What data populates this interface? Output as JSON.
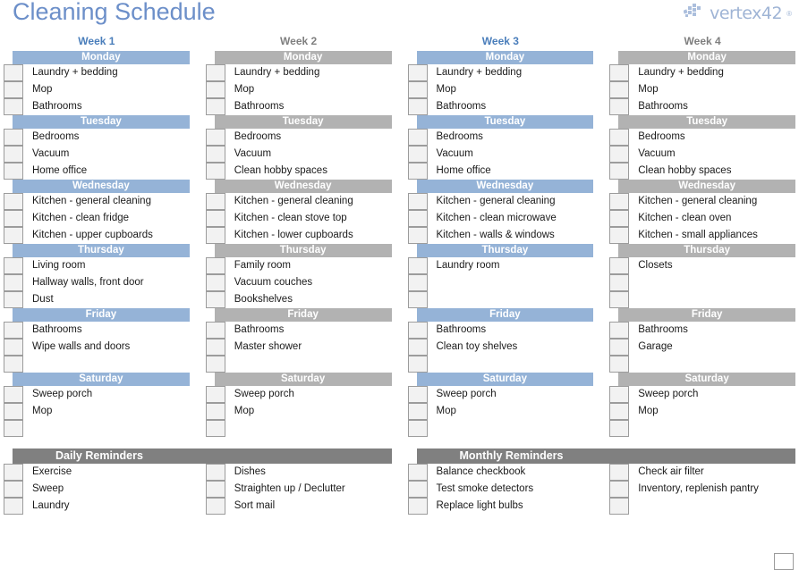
{
  "header": {
    "title": "Cleaning Schedule",
    "brand_name": "vertex42",
    "brand_sup": "®",
    "brand_icon": "vertex42-logo-icon"
  },
  "weeks": [
    {
      "title": "Week 1",
      "accent": "blue",
      "days": [
        {
          "name": "Monday",
          "tasks": [
            "Laundry + bedding",
            "Mop",
            "Bathrooms"
          ]
        },
        {
          "name": "Tuesday",
          "tasks": [
            "Bedrooms",
            "Vacuum",
            "Home office"
          ]
        },
        {
          "name": "Wednesday",
          "tasks": [
            "Kitchen - general cleaning",
            "Kitchen - clean fridge",
            "Kitchen - upper cupboards"
          ]
        },
        {
          "name": "Thursday",
          "tasks": [
            "Living room",
            "Hallway walls, front door",
            "Dust"
          ]
        },
        {
          "name": "Friday",
          "tasks": [
            "Bathrooms",
            "Wipe walls and doors",
            ""
          ]
        },
        {
          "name": "Saturday",
          "tasks": [
            "Sweep porch",
            "Mop",
            ""
          ]
        }
      ]
    },
    {
      "title": "Week 2",
      "accent": "gray",
      "days": [
        {
          "name": "Monday",
          "tasks": [
            "Laundry + bedding",
            "Mop",
            "Bathrooms"
          ]
        },
        {
          "name": "Tuesday",
          "tasks": [
            "Bedrooms",
            "Vacuum",
            "Clean hobby spaces"
          ]
        },
        {
          "name": "Wednesday",
          "tasks": [
            "Kitchen - general cleaning",
            "Kitchen - clean stove top",
            "Kitchen - lower cupboards"
          ]
        },
        {
          "name": "Thursday",
          "tasks": [
            "Family room",
            "Vacuum couches",
            "Bookshelves"
          ]
        },
        {
          "name": "Friday",
          "tasks": [
            "Bathrooms",
            "Master shower",
            ""
          ]
        },
        {
          "name": "Saturday",
          "tasks": [
            "Sweep porch",
            "Mop",
            ""
          ]
        }
      ]
    },
    {
      "title": "Week 3",
      "accent": "blue",
      "days": [
        {
          "name": "Monday",
          "tasks": [
            "Laundry + bedding",
            "Mop",
            "Bathrooms"
          ]
        },
        {
          "name": "Tuesday",
          "tasks": [
            "Bedrooms",
            "Vacuum",
            "Home office"
          ]
        },
        {
          "name": "Wednesday",
          "tasks": [
            "Kitchen - general cleaning",
            "Kitchen - clean microwave",
            "Kitchen - walls & windows"
          ]
        },
        {
          "name": "Thursday",
          "tasks": [
            "Laundry room",
            "",
            ""
          ]
        },
        {
          "name": "Friday",
          "tasks": [
            "Bathrooms",
            "Clean toy shelves",
            ""
          ]
        },
        {
          "name": "Saturday",
          "tasks": [
            "Sweep porch",
            "Mop",
            ""
          ]
        }
      ]
    },
    {
      "title": "Week 4",
      "accent": "gray",
      "days": [
        {
          "name": "Monday",
          "tasks": [
            "Laundry + bedding",
            "Mop",
            "Bathrooms"
          ]
        },
        {
          "name": "Tuesday",
          "tasks": [
            "Bedrooms",
            "Vacuum",
            "Clean hobby spaces"
          ]
        },
        {
          "name": "Wednesday",
          "tasks": [
            "Kitchen - general cleaning",
            "Kitchen - clean oven",
            "Kitchen - small appliances"
          ]
        },
        {
          "name": "Thursday",
          "tasks": [
            "Closets",
            "",
            ""
          ]
        },
        {
          "name": "Friday",
          "tasks": [
            "Bathrooms",
            "Garage",
            ""
          ]
        },
        {
          "name": "Saturday",
          "tasks": [
            "Sweep porch",
            "Mop",
            ""
          ]
        }
      ]
    }
  ],
  "reminders": [
    {
      "title": "Daily Reminders",
      "columns": [
        [
          "Exercise",
          "Sweep",
          "Laundry"
        ],
        [
          "Dishes",
          "Straighten up / Declutter",
          "Sort mail"
        ]
      ]
    },
    {
      "title": "Monthly Reminders",
      "columns": [
        [
          "Balance checkbook",
          "Test smoke detectors",
          "Replace light bulbs"
        ],
        [
          "Check air filter",
          "Inventory, replenish pantry",
          ""
        ]
      ]
    }
  ],
  "colors": {
    "title_blue": "#6c8fc9",
    "week_blue": "#4a7ebb",
    "week_gray": "#7f7f7f",
    "day_blue": "#95b3d7",
    "day_gray": "#b2b2b2",
    "reminder_header": "#808080",
    "checkbox_fill": "#f2f2f2",
    "checkbox_border": "#9c9c9c"
  }
}
